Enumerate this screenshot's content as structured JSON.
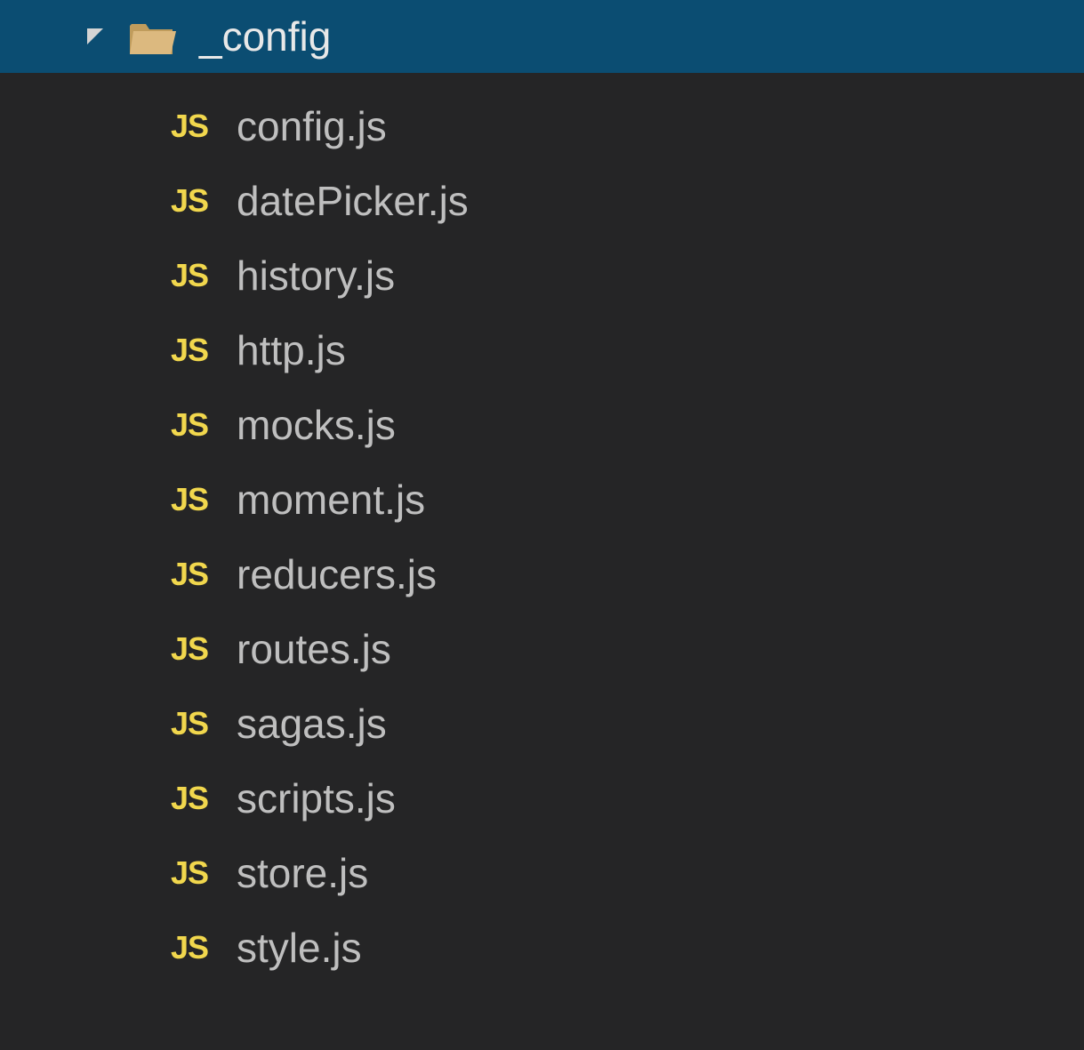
{
  "folder": {
    "name": "_config",
    "expanded": true
  },
  "files": [
    {
      "icon": "JS",
      "name": "config.js"
    },
    {
      "icon": "JS",
      "name": "datePicker.js"
    },
    {
      "icon": "JS",
      "name": "history.js"
    },
    {
      "icon": "JS",
      "name": "http.js"
    },
    {
      "icon": "JS",
      "name": "mocks.js"
    },
    {
      "icon": "JS",
      "name": "moment.js"
    },
    {
      "icon": "JS",
      "name": "reducers.js"
    },
    {
      "icon": "JS",
      "name": "routes.js"
    },
    {
      "icon": "JS",
      "name": "sagas.js"
    },
    {
      "icon": "JS",
      "name": "scripts.js"
    },
    {
      "icon": "JS",
      "name": "store.js"
    },
    {
      "icon": "JS",
      "name": "style.js"
    }
  ]
}
